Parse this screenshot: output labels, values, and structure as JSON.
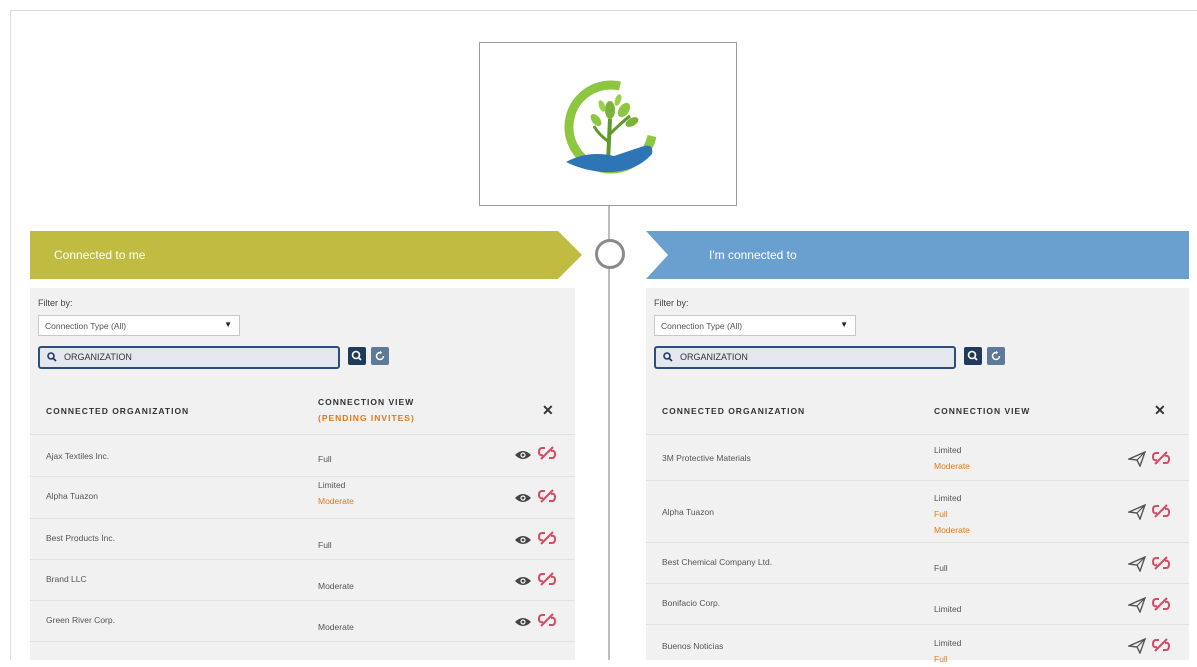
{
  "left": {
    "banner": "Connected to me",
    "filter_label": "Filter by:",
    "select_value": "Connection Type (All)",
    "search_value": "ORGANIZATION",
    "col_org": "CONNECTED ORGANIZATION",
    "col_view": "CONNECTION VIEW",
    "col_view_sub": "(PENDING INVITES)",
    "rows": [
      {
        "org": "Ajax Textiles Inc.",
        "view": [
          "Full"
        ]
      },
      {
        "org": "Alpha Tuazon",
        "view": [
          "Limited",
          "Moderate"
        ]
      },
      {
        "org": "Best Products Inc.",
        "view": [
          "Full"
        ]
      },
      {
        "org": "Brand LLC",
        "view": [
          "Moderate"
        ]
      },
      {
        "org": "Green River Corp.",
        "view": [
          "Moderate"
        ]
      }
    ]
  },
  "right": {
    "banner": "I'm connected to",
    "filter_label": "Filter by:",
    "select_value": "Connection Type (All)",
    "search_value": "ORGANIZATION",
    "col_org": "CONNECTED ORGANIZATION",
    "col_view": "CONNECTION VIEW",
    "rows": [
      {
        "org": "3M Protective Materials",
        "view": [
          "Limited",
          "Moderate"
        ]
      },
      {
        "org": "Alpha Tuazon",
        "view": [
          "Limited",
          "Full",
          "Moderate"
        ]
      },
      {
        "org": "Best Chemical Company Ltd.",
        "view": [
          "Full"
        ]
      },
      {
        "org": "Bonifacio Corp.",
        "view": [
          "Limited"
        ]
      },
      {
        "org": "Buenos Noticias",
        "view": [
          "Limited",
          "Full"
        ]
      }
    ]
  },
  "colors": {
    "left_banner": "#c0bc41",
    "right_banner": "#6aa0cf",
    "pending_orange": "#e07a1e",
    "search_border": "#2d4d7a"
  },
  "icons": {
    "view_action": "eye-icon",
    "send_action": "send-icon",
    "disconnect_action": "unlink-icon",
    "expand": "expand-icon",
    "search": "search-icon",
    "refresh": "refresh-icon"
  }
}
